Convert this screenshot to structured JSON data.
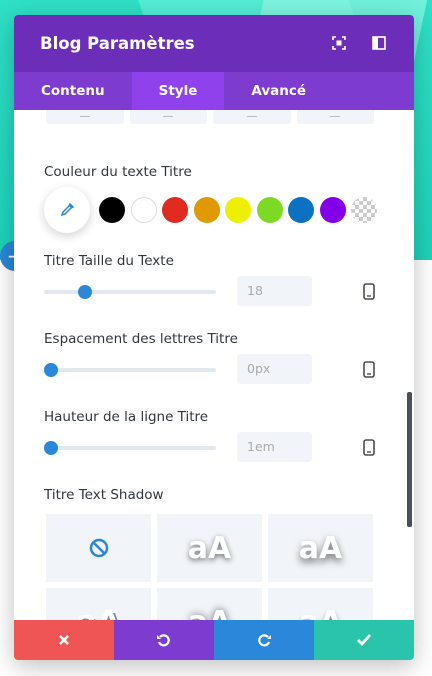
{
  "modal": {
    "title": "Blog Paramètres",
    "header_icons": [
      "fullscreen-icon",
      "split-view-icon"
    ]
  },
  "tabs": [
    {
      "label": "Contenu",
      "active": false
    },
    {
      "label": "Style",
      "active": true
    },
    {
      "label": "Avancé",
      "active": false
    }
  ],
  "text_color": {
    "label": "Couleur du texte Titre",
    "swatches": [
      "#000000",
      "#ffffff",
      "#e02b20",
      "#e09900",
      "#edf000",
      "#7cda24",
      "#0c71c3",
      "#8300e9",
      "transparent"
    ]
  },
  "font_size": {
    "label": "Titre Taille du Texte",
    "value": "18",
    "slider_fraction": 0.2
  },
  "letter_spacing": {
    "label": "Espacement des lettres Titre",
    "value": "0px",
    "slider_fraction": 0
  },
  "line_height": {
    "label": "Hauteur de la ligne Titre",
    "value": "1em",
    "slider_fraction": 0
  },
  "text_shadow": {
    "label": "Titre Text Shadow",
    "preset_text": "aA",
    "presets": [
      "none",
      "shadow-1",
      "shadow-2",
      "shadow-3",
      "shadow-4",
      "shadow-5"
    ]
  },
  "footer": {
    "colors": {
      "cancel": "#ef5555",
      "undo": "#7e3bd0",
      "redo": "#2b87da",
      "save": "#29c4a9"
    }
  },
  "colors": {
    "header": "#6c2eb9",
    "tabs": "#7e3bd0",
    "active_tab": "#8f42ec",
    "accent": "#2b87da"
  }
}
